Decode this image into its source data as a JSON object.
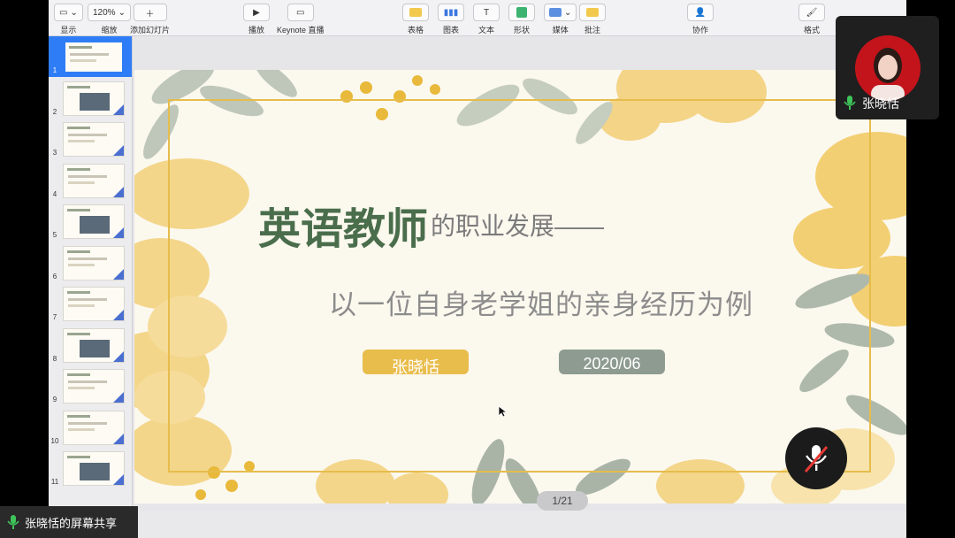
{
  "toolbar": {
    "view_label": "显示",
    "zoom_value": "120%",
    "zoom_label": "缩放",
    "add_slide_label": "添加幻灯片",
    "play_label": "播放",
    "keynote_live_label": "Keynote 直播",
    "table_label": "表格",
    "chart_label": "图表",
    "text_label": "文本",
    "shape_label": "形状",
    "media_label": "媒体",
    "comment_label": "批注",
    "collaborate_label": "协作",
    "format_label": "格式"
  },
  "navigator": {
    "slide_numbers": [
      "1",
      "2",
      "3",
      "4",
      "5",
      "6",
      "7",
      "8",
      "9",
      "10",
      "11"
    ],
    "selected": "1"
  },
  "slide": {
    "title_main": "英语教师",
    "title_rest": "的职业发展——",
    "subtitle": "以一位自身老学姐的亲身经历为例",
    "presenter": "张晓恬",
    "date": "2020/06"
  },
  "page_indicator": "1/21",
  "video": {
    "participant_name": "张晓恬"
  },
  "share_bar": {
    "label": "张晓恬的屏幕共享"
  },
  "colors": {
    "accent_yellow": "#e9bd4c",
    "title_green": "#4a6e4c",
    "date_grey_green": "#8d9b90",
    "selection_blue": "#2f7df6",
    "avatar_red": "#c3141b"
  }
}
